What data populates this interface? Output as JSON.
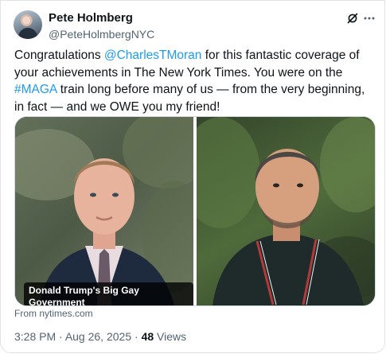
{
  "author": {
    "display_name": "Pete Holmberg",
    "handle": "@PeteHolmbergNYC"
  },
  "post": {
    "text_before_mention": "Congratulations ",
    "mention": "@CharlesTMoran",
    "text_after_mention": " for this fantastic coverage of your achievements in The New York Times. You were on the ",
    "hashtag": "#MAGA",
    "text_after_hashtag": " train long before many of us — from the very beginning, in fact — and we OWE you my friend!"
  },
  "link_card": {
    "caption": "Donald Trump's Big Gay Government",
    "source": "From nytimes.com"
  },
  "meta": {
    "time": "3:28 PM",
    "separator": " · ",
    "date": "Aug 26, 2025",
    "views_count": "48",
    "views_label": " Views"
  },
  "colors": {
    "link": "#1d9bf0",
    "secondary_text": "#536471",
    "primary_text": "#0f1419"
  },
  "icons": {
    "header_actions": [
      "grok-icon",
      "more-options-icon"
    ]
  }
}
